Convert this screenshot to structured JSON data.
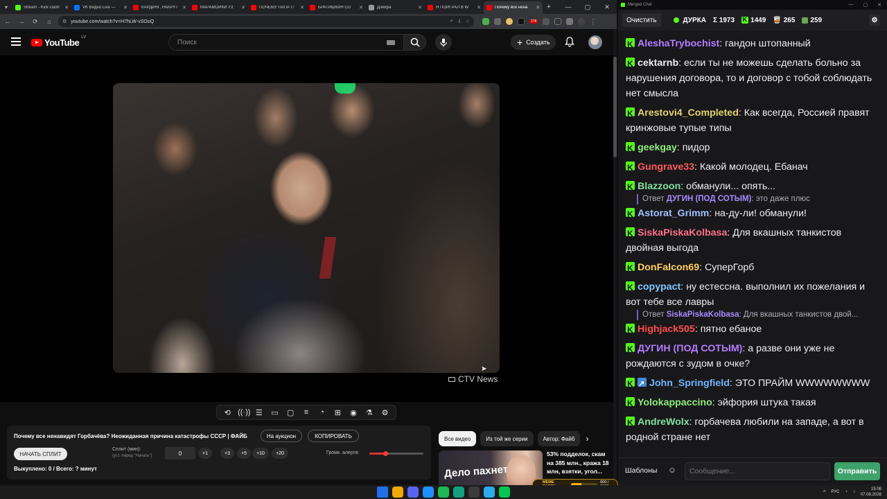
{
  "browser": {
    "tabs": [
      {
        "title": "Stream - Kick Dash",
        "color": "#53fc18",
        "active": false
      },
      {
        "title": "VK Видео Live —",
        "color": "#0077ff",
        "active": false
      },
      {
        "title": "КАРДИНГ, НАКРУТ",
        "color": "#ff0000",
        "active": false
      },
      {
        "title": "МАРАМОЙКИ УЗ",
        "color": "#ff0000",
        "active": false
      },
      {
        "title": "ПОЧЕМУ ПАПА П",
        "color": "#ff0000",
        "active": false
      },
      {
        "title": "БРАТИШКИН СО",
        "color": "#ff0000",
        "active": false
      },
      {
        "title": "Дзейра",
        "color": "#999999",
        "active": false
      },
      {
        "title": "Я ПОИГРАЛ В W",
        "color": "#ff0000",
        "active": false
      },
      {
        "title": "Почему все нена",
        "color": "#ff0000",
        "active": true
      }
    ],
    "url": "youtube.com/watch?v=H7hLW-vSOoQ",
    "ext_badge": "278"
  },
  "youtube": {
    "logo_text": "YouTube",
    "country_code": "LV",
    "search_placeholder": "Поиск",
    "create_label": "Создать"
  },
  "video": {
    "watermark": "CTV News"
  },
  "player_tools": [
    "⟲",
    "((·))",
    "☰",
    "▭",
    "▢",
    "≡",
    "◔",
    "⊞",
    "◉",
    "⚗",
    "⚙"
  ],
  "info_panel": {
    "title": "Почему все ненавидят Горбачёва? Неожиданная причина катастрофы СССР | ФАЙБ",
    "auction_label": "На аукцион",
    "copy_label": "КОПИРОВАТЬ",
    "split_button": "НАЧАТЬ СПЛИТ",
    "split_label": "Сплит (мин):",
    "split_sub": "(уст. перед \"Начать\")",
    "split_value": "0",
    "increments": [
      "+1",
      "+3",
      "+5",
      "+10",
      "+20"
    ],
    "alert_label": "Громк. алерта:",
    "alert_volume": 0.3,
    "bought": "Выкуплено: 0 / Всего: ? минут"
  },
  "recommendations": {
    "chips": [
      "Все видео",
      "Из той же серии",
      "Автор: Файб"
    ],
    "thumb_text": "Дело пахнет",
    "item_title": "53% подделок, скам на 385 млн., кража 18 млн, взятки, угол..."
  },
  "meme_party": {
    "label": "MEME PARTY",
    "count": "600 / 1500",
    "progress": 0.4
  },
  "chat": {
    "window_title": "Merged Chat",
    "clear_label": "Очистить",
    "streamer": "ДУРКА",
    "stats": {
      "total": "Σ 1973",
      "kick": "1449",
      "vk": "265",
      "other": "259"
    },
    "messages": [
      {
        "user": "AleshaTrybochist",
        "color": "#b57dff",
        "text": "гандон штопанный"
      },
      {
        "user": "cektarnb",
        "color": "#efeff1",
        "text": "если ты не можешь сделать больно за нарушения договора, то и договор с тобой соблюдать нет смысла"
      },
      {
        "user": "Arestovi4_Completed",
        "color": "#e5d36a",
        "text": "Как всегда, Россией правят кринжовые тупые типы"
      },
      {
        "user": "geekgay",
        "color": "#8ff07a",
        "text": "пидор"
      },
      {
        "user": "Gungrave33",
        "color": "#ff5a5a",
        "text": "Какой молодец. Ебанач"
      },
      {
        "user": "Blazzoon",
        "color": "#7ee3a2",
        "text": "обманули... опять..."
      },
      {
        "user": "Astorat_Grimm",
        "color": "#9fc2ff",
        "text": "на-ду-ли! обманули!",
        "reply_label": "Ответ",
        "reply_user": "ДУГИН (ПОД СОТЫМ)",
        "reply_text": "это даже плюс"
      },
      {
        "user": "SiskaPiskaKolbasa",
        "color": "#ff6f8a",
        "text": "Для вкашных танкистов двойная выгода"
      },
      {
        "user": "DonFalcon69",
        "color": "#ffd25a",
        "text": "СуперГорб"
      },
      {
        "user": "copypact",
        "color": "#7fc7ff",
        "text": "ну естессна. выполнил их пожелания и вот тебе все  лавры"
      },
      {
        "user": "Highjack505",
        "color": "#ff4d4d",
        "text": "пятно ебаное",
        "reply_label": "Ответ",
        "reply_user": "SiskaPiskaKolbasa",
        "reply_text": "Для вкашных танкистов двой..."
      },
      {
        "user": "ДУГИН (ПОД СОТЫМ)",
        "color": "#b57dff",
        "text": "а разве они уже не рождаются с зудом в очке?"
      },
      {
        "user": "John_Springfield",
        "color": "#6fb6ff",
        "text": "ЭТО ПРАЙМ WWWWWWWW",
        "badge2": true
      },
      {
        "user": "Yolokappaccino",
        "color": "#8ff07a",
        "text": "эйфория штука такая"
      },
      {
        "user": "AndreWolx",
        "color": "#7ee3a2",
        "text": "горбачева любили на западе, а вот в родной стране нет"
      }
    ],
    "templates_label": "Шаблоны",
    "input_placeholder": "Сообщение...",
    "send_label": "Отправить"
  },
  "taskbar": {
    "lang": "РУС",
    "time": "15:08",
    "date": "07.08.2026",
    "icons": [
      "#1f6feb",
      "#f2a900",
      "#5865f2",
      "#1e90ff",
      "#1db954",
      "#11a37f",
      "#3b3b3b",
      "#2aabee",
      "#00c853"
    ]
  }
}
